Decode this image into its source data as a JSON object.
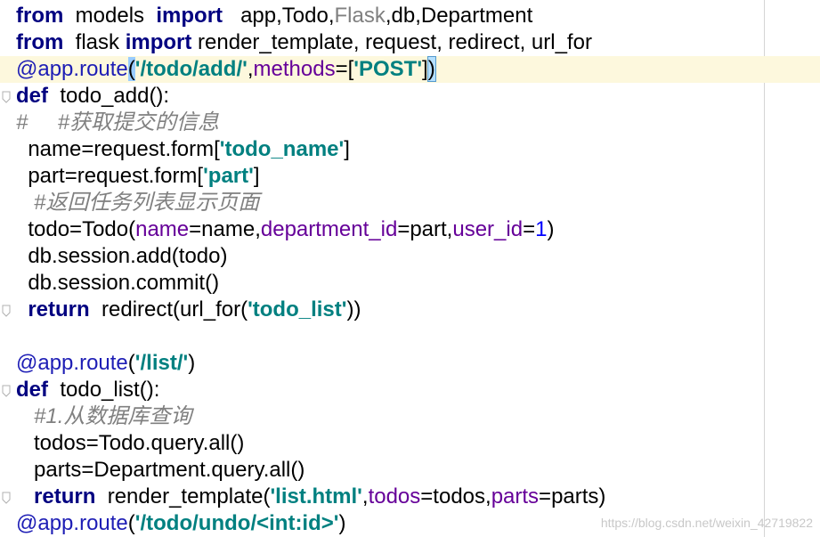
{
  "lines": [
    {
      "segments": [
        {
          "t": "from",
          "c": "kw"
        },
        {
          "t": "  models  ",
          "c": ""
        },
        {
          "t": "import",
          "c": "kw"
        },
        {
          "t": "   app,Todo,",
          "c": ""
        },
        {
          "t": "Flask",
          "c": "unused"
        },
        {
          "t": ",db,Department",
          "c": ""
        }
      ]
    },
    {
      "segments": [
        {
          "t": "from",
          "c": "kw"
        },
        {
          "t": "  flask ",
          "c": ""
        },
        {
          "t": "import",
          "c": "kw"
        },
        {
          "t": " render_template, request, redirect, url_for",
          "c": ""
        }
      ]
    },
    {
      "hl": true,
      "segments": [
        {
          "t": "@app.route",
          "c": "deco"
        },
        {
          "t": "(",
          "c": "bracket-match"
        },
        {
          "t": "'/todo/add/'",
          "c": "str"
        },
        {
          "t": ",",
          "c": ""
        },
        {
          "t": "methods",
          "c": "param"
        },
        {
          "t": "=[",
          "c": ""
        },
        {
          "t": "'POST'",
          "c": "str"
        },
        {
          "t": "]",
          "c": ""
        },
        {
          "t": ")",
          "c": "bracket-match2"
        }
      ]
    },
    {
      "fold": true,
      "segments": [
        {
          "t": "def",
          "c": "kw"
        },
        {
          "t": "  todo_add():",
          "c": ""
        }
      ]
    },
    {
      "segments": [
        {
          "t": "#     #获取提交的信息",
          "c": "cmt"
        }
      ]
    },
    {
      "segments": [
        {
          "t": "  name=request.form[",
          "c": ""
        },
        {
          "t": "'todo_name'",
          "c": "str"
        },
        {
          "t": "]",
          "c": ""
        }
      ]
    },
    {
      "segments": [
        {
          "t": "  part=request.form[",
          "c": ""
        },
        {
          "t": "'part'",
          "c": "str"
        },
        {
          "t": "]",
          "c": ""
        }
      ]
    },
    {
      "segments": [
        {
          "t": "   #返回任务列表显示页面",
          "c": "cmt"
        }
      ]
    },
    {
      "segments": [
        {
          "t": "  todo=Todo(",
          "c": ""
        },
        {
          "t": "name",
          "c": "param"
        },
        {
          "t": "=name,",
          "c": ""
        },
        {
          "t": "department_id",
          "c": "param"
        },
        {
          "t": "=part,",
          "c": ""
        },
        {
          "t": "user_id",
          "c": "param"
        },
        {
          "t": "=",
          "c": ""
        },
        {
          "t": "1",
          "c": "num"
        },
        {
          "t": ")",
          "c": ""
        }
      ]
    },
    {
      "segments": [
        {
          "t": "  db.session.add(todo)",
          "c": ""
        }
      ]
    },
    {
      "segments": [
        {
          "t": "  db.session.commit()",
          "c": ""
        }
      ]
    },
    {
      "fold": true,
      "segments": [
        {
          "t": "  ",
          "c": ""
        },
        {
          "t": "return",
          "c": "kw"
        },
        {
          "t": "  redirect(url_for(",
          "c": ""
        },
        {
          "t": "'todo_list'",
          "c": "str"
        },
        {
          "t": "))",
          "c": ""
        }
      ]
    },
    {
      "segments": [
        {
          "t": " ",
          "c": ""
        }
      ]
    },
    {
      "segments": [
        {
          "t": "@app.route",
          "c": "deco"
        },
        {
          "t": "(",
          "c": ""
        },
        {
          "t": "'/list/'",
          "c": "str"
        },
        {
          "t": ")",
          "c": ""
        }
      ]
    },
    {
      "fold": true,
      "segments": [
        {
          "t": "def",
          "c": "kw"
        },
        {
          "t": "  todo_list():",
          "c": ""
        }
      ]
    },
    {
      "segments": [
        {
          "t": "   #1.从数据库查询",
          "c": "cmt"
        }
      ]
    },
    {
      "segments": [
        {
          "t": "   todos=Todo.query.all()",
          "c": ""
        }
      ]
    },
    {
      "segments": [
        {
          "t": "   parts=Department.query.all()",
          "c": ""
        }
      ]
    },
    {
      "fold": true,
      "segments": [
        {
          "t": "   ",
          "c": ""
        },
        {
          "t": "return",
          "c": "kw"
        },
        {
          "t": "  render_template(",
          "c": ""
        },
        {
          "t": "'list.html'",
          "c": "str"
        },
        {
          "t": ",",
          "c": ""
        },
        {
          "t": "todos",
          "c": "param"
        },
        {
          "t": "=todos,",
          "c": ""
        },
        {
          "t": "parts",
          "c": "param"
        },
        {
          "t": "=parts)",
          "c": ""
        }
      ]
    },
    {
      "segments": [
        {
          "t": "@app.route",
          "c": "deco"
        },
        {
          "t": "(",
          "c": ""
        },
        {
          "t": "'/todo/undo/<int:id>'",
          "c": "str"
        },
        {
          "t": ")",
          "c": ""
        }
      ]
    }
  ],
  "watermark": "https://blog.csdn.net/weixin_42719822",
  "fold_icon": "fold-marker-icon",
  "colors": {
    "keyword": "#000080",
    "string": "#008080",
    "decorator": "#1d1db5",
    "param": "#660099",
    "number": "#0000ff",
    "comment": "#808080",
    "current_line": "#fdf8dd"
  }
}
